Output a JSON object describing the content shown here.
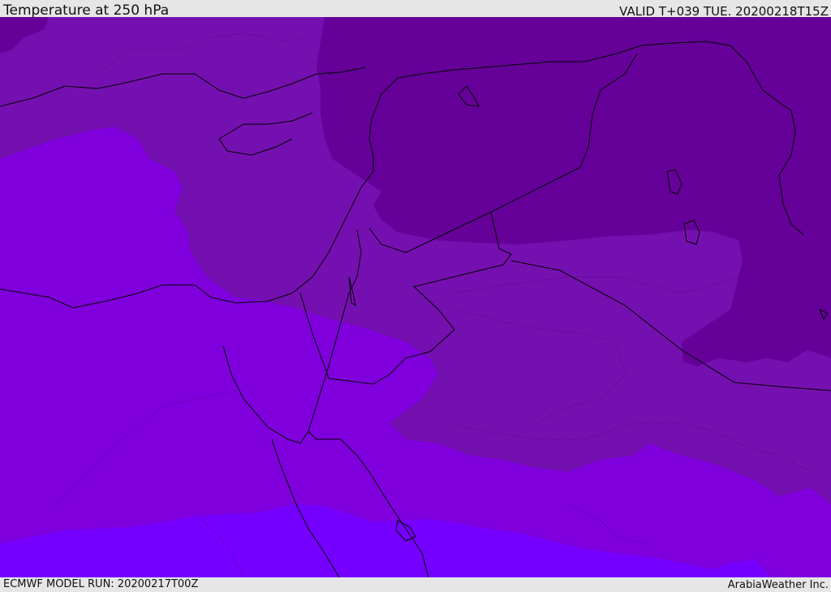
{
  "header": {
    "title": "Temperature at 250 hPa",
    "valid": "VALID T+039 TUE. 20200218T15Z"
  },
  "footer": {
    "model_run": "ECMWF MODEL RUN: 20200217T00Z",
    "credit": "ArabiaWeather Inc."
  },
  "map": {
    "field": "temperature",
    "level": "250 hPa",
    "colors": {
      "coldest": "#650099",
      "cold": "#7510b0",
      "mid": "#7f00dd",
      "warm": "#7500ff",
      "coastline": "#000000"
    }
  }
}
